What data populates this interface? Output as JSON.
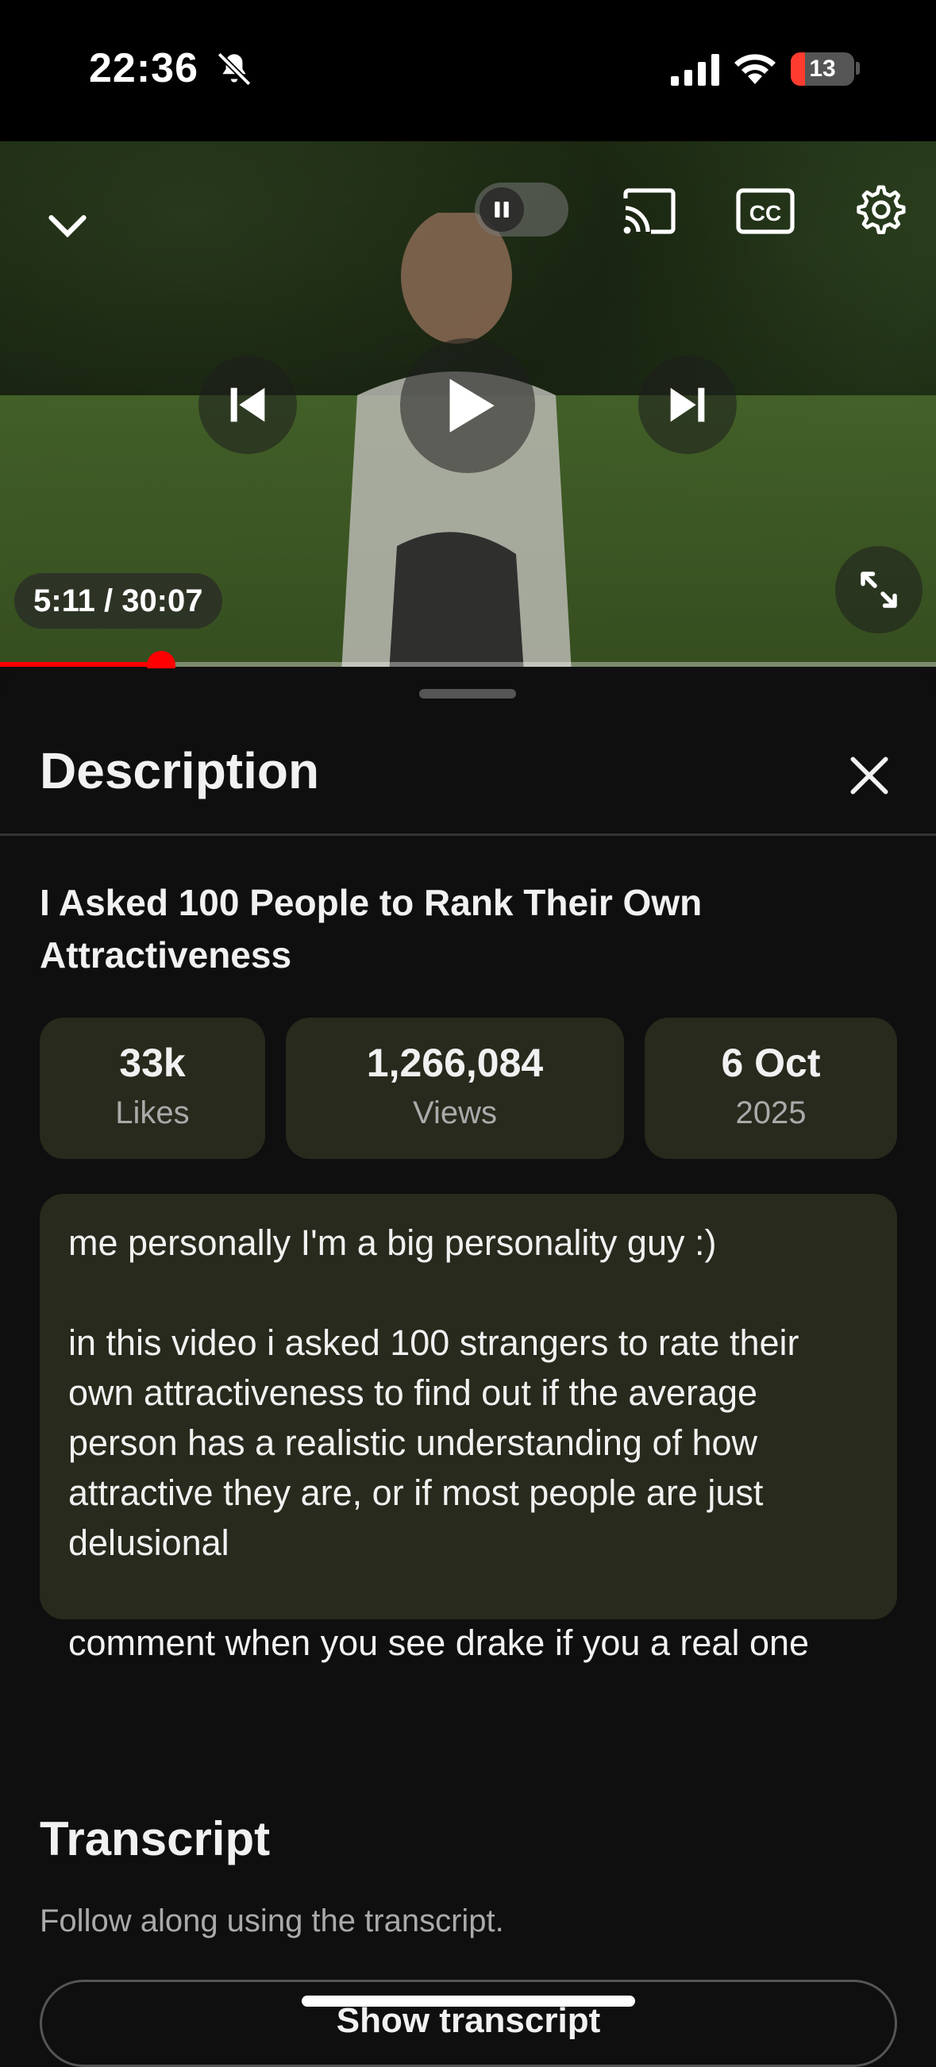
{
  "status_bar": {
    "time": "22:36",
    "battery": "13"
  },
  "player": {
    "time_display": "5:11 / 30:07",
    "progress": 0.172
  },
  "sheet": {
    "title": "Description",
    "video_title": "I Asked 100 People to Rank Their Own Attractiveness",
    "stats": [
      {
        "value": "33k",
        "label": "Likes"
      },
      {
        "value": "1,266,084",
        "label": "Views"
      },
      {
        "value": "6 Oct",
        "label": "2025"
      }
    ],
    "description": "me personally I'm a big personality guy :)\n\nin this video i asked 100 strangers to rate their own attractiveness to find out if the average person has a realistic understanding of how attractive they are, or if most people are just delusional\n\ncomment when you see drake if you a real one",
    "transcript": {
      "title": "Transcript",
      "subtitle": "Follow along using the transcript.",
      "button": "Show transcript"
    }
  },
  "colors": {
    "accent": "#ff0000",
    "card": "#272a1c",
    "background": "#0f0f0f"
  }
}
